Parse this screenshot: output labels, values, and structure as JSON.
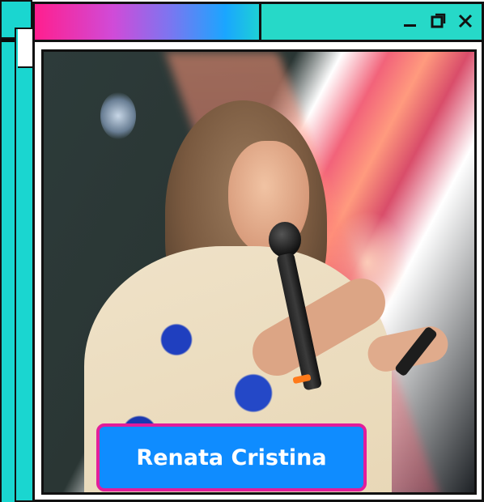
{
  "window": {
    "controls": [
      {
        "icon": "minimize-icon"
      },
      {
        "icon": "restore-icon"
      },
      {
        "icon": "close-icon"
      }
    ],
    "titlebar_colors": {
      "gradient_start": "#ff1f8e",
      "gradient_mid": "#7d75f0",
      "gradient_end": "#1dd0d6",
      "teal": "#26d9c8"
    }
  },
  "photo": {
    "subject": "speaker-with-microphone-on-stage"
  },
  "badge": {
    "name": "Renata Cristina",
    "background": "#0f8cff",
    "border": "#e21d9b"
  }
}
